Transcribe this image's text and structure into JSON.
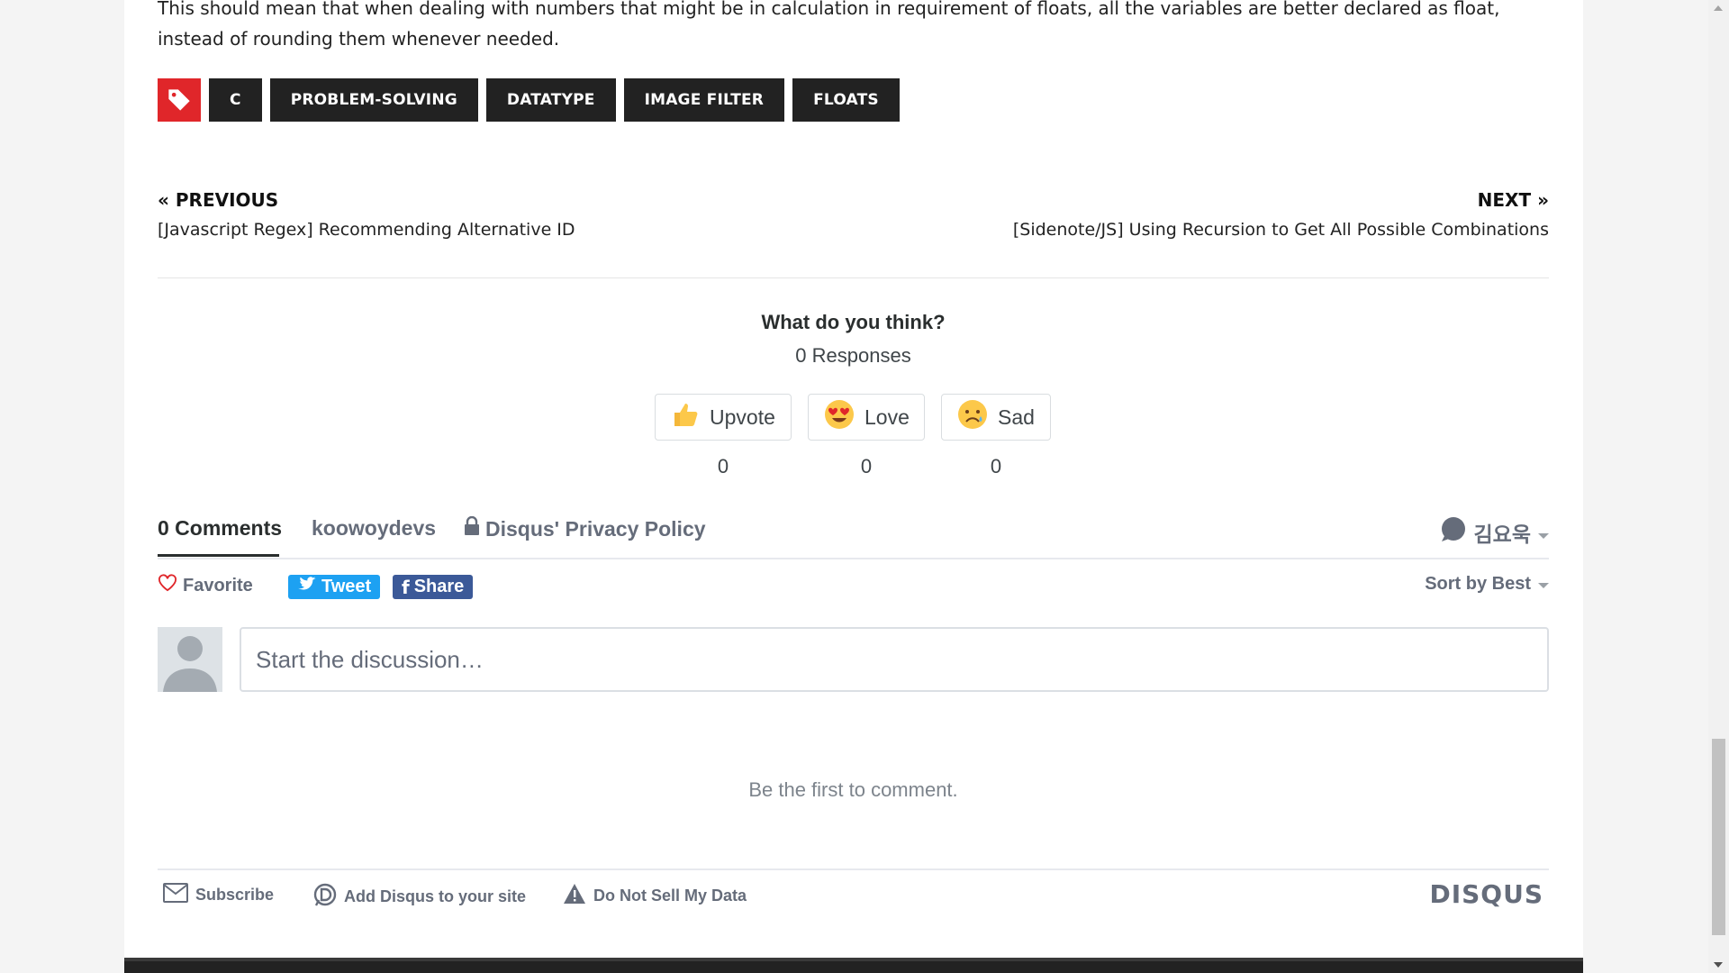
{
  "article": {
    "text": "This should mean that when dealing with numbers that might be in calculation in requirement of floats, all the variables are better declared as float, instead of rounding them whenever needed."
  },
  "tags": {
    "icon": "tag-icon",
    "items": [
      "C",
      "PROBLEM-SOLVING",
      "DATATYPE",
      "IMAGE FILTER",
      "FLOATS"
    ]
  },
  "post_nav": {
    "previous_label": "« PREVIOUS",
    "previous_title": "[Javascript Regex] Recommending Alternative ID",
    "next_label": "NEXT »",
    "next_title": "[Sidenote/JS] Using Recursion to Get All Possible Combinations"
  },
  "reactions": {
    "title": "What do you think?",
    "responses": "0 Responses",
    "items": [
      {
        "label": "Upvote",
        "icon": "thumbs-up-icon",
        "count": "0"
      },
      {
        "label": "Love",
        "icon": "heart-eyes-icon",
        "count": "0"
      },
      {
        "label": "Sad",
        "icon": "sad-face-icon",
        "count": "0"
      }
    ]
  },
  "disqus": {
    "tabs": {
      "comments": "0 Comments",
      "community": "koowoydevs",
      "privacy": "Disqus' Privacy Policy"
    },
    "user": "김요욱",
    "favorite": "Favorite",
    "tweet": "Tweet",
    "share": "Share",
    "sort": "Sort by Best",
    "placeholder": "Start the discussion…",
    "empty": "Be the first to comment.",
    "footer": {
      "subscribe": "Subscribe",
      "add_disqus": "Add Disqus to your site",
      "do_not_sell": "Do Not Sell My Data",
      "logo": "DISQUS"
    }
  },
  "colors": {
    "tag_icon_bg": "#e0262a",
    "tag_bg": "#222222",
    "tweet_bg": "#1da1f2",
    "facebook_bg": "#3b5998",
    "disqus_text": "#656c7a"
  }
}
